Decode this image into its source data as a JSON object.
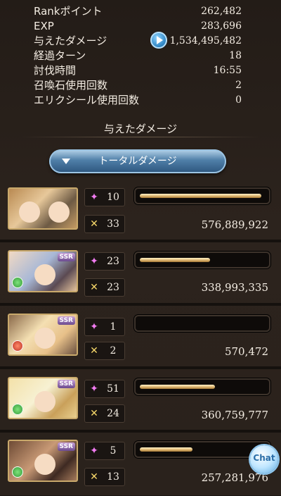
{
  "stats": [
    {
      "label": "Rankポイント",
      "value": "262,482"
    },
    {
      "label": "EXP",
      "value": "283,696"
    },
    {
      "label": "与えたダメージ",
      "value": "1,534,495,482"
    },
    {
      "label": "経過ターン",
      "value": "18"
    },
    {
      "label": "討伐時間",
      "value": "16:55"
    },
    {
      "label": "召喚石使用回数",
      "value": "2"
    },
    {
      "label": "エリクシール使用回数",
      "value": "0"
    }
  ],
  "section": {
    "title": "与えたダメージ"
  },
  "selector": {
    "label": "トータルダメージ"
  },
  "badges": {
    "ssr": "SSR"
  },
  "cards": [
    {
      "hits": "10",
      "crits": "33",
      "damage": "576,889,922",
      "fill": 0.97
    },
    {
      "hits": "23",
      "crits": "23",
      "damage": "338,993,335",
      "fill": 0.56
    },
    {
      "hits": "1",
      "crits": "2",
      "damage": "570,472",
      "fill": 0.0
    },
    {
      "hits": "51",
      "crits": "24",
      "damage": "360,759,777",
      "fill": 0.6
    },
    {
      "hits": "5",
      "crits": "13",
      "damage": "257,281,976",
      "fill": 0.42
    }
  ],
  "chat": {
    "label": "Chat"
  },
  "icons": {
    "hits": "star-sparkle-icon",
    "crits": "crossed-swords-icon",
    "play": "play-icon"
  }
}
